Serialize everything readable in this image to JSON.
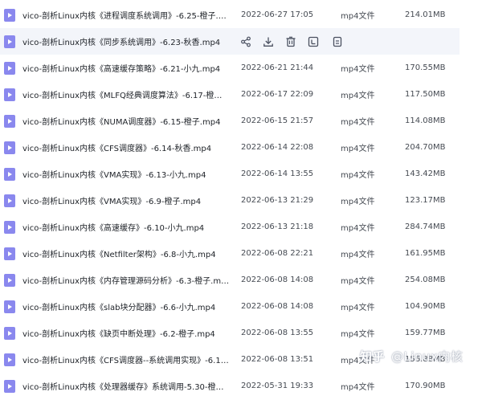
{
  "files": [
    {
      "name": "vico-剖析Linux内核《进程调度系统调用》-6.25-橙子.mp4",
      "date": "2022-06-27 17:05",
      "type": "mp4文件",
      "size": "214.01MB"
    },
    {
      "name": "vico-剖析Linux内核《同步系统调用》-6.23-秋香.mp4",
      "date": "",
      "type": "",
      "size": ""
    },
    {
      "name": "vico-剖析Linux内核《高速缓存策略》-6.21-小九.mp4",
      "date": "2022-06-21 21:44",
      "type": "mp4文件",
      "size": "170.55MB"
    },
    {
      "name": "vico-剖析Linux内核《MLFQ经典调度算法》-6.17-橙子....",
      "date": "2022-06-17 22:09",
      "type": "mp4文件",
      "size": "117.50MB"
    },
    {
      "name": "vico-剖析Linux内核《NUMA调度器》-6.15-橙子.mp4",
      "date": "2022-06-15 21:57",
      "type": "mp4文件",
      "size": "114.08MB"
    },
    {
      "name": "vico-剖析Linux内核《CFS调度器》-6.14-秋香.mp4",
      "date": "2022-06-14 22:08",
      "type": "mp4文件",
      "size": "204.70MB"
    },
    {
      "name": "vico-剖析Linux内核《VMA实现》-6.13-小九.mp4",
      "date": "2022-06-14 13:55",
      "type": "mp4文件",
      "size": "143.42MB"
    },
    {
      "name": "vico-剖析Linux内核《VMA实现》-6.9-橙子.mp4",
      "date": "2022-06-13 21:29",
      "type": "mp4文件",
      "size": "123.17MB"
    },
    {
      "name": "vico-剖析Linux内核《高速缓存》-6.10-小九.mp4",
      "date": "2022-06-13 21:18",
      "type": "mp4文件",
      "size": "284.74MB"
    },
    {
      "name": "vico-剖析Linux内核《Netfilter架构》-6.8-小九.mp4",
      "date": "2022-06-08 22:21",
      "type": "mp4文件",
      "size": "161.95MB"
    },
    {
      "name": "vico-剖析Linux内核《内存管理源码分析》-6.3-橙子.mp4",
      "date": "2022-06-08 14:08",
      "type": "mp4文件",
      "size": "254.08MB"
    },
    {
      "name": "vico-剖析Linux内核《slab块分配器》-6.6-小九.mp4",
      "date": "2022-06-08 14:08",
      "type": "mp4文件",
      "size": "104.90MB"
    },
    {
      "name": "vico-剖析Linux内核《缺页中断处理》-6.2-橙子.mp4",
      "date": "2022-06-08 13:55",
      "type": "mp4文件",
      "size": "159.77MB"
    },
    {
      "name": "vico-剖析Linux内核《CFS调度器--系统调用实现》-6.1-...",
      "date": "2022-06-08 13:51",
      "type": "mp4文件",
      "size": "156.88MB"
    },
    {
      "name": "vico-剖析Linux内核《处理器缓存》系统调用-5.30-橙子....",
      "date": "2022-05-31 19:33",
      "type": "mp4文件",
      "size": "170.90MB"
    }
  ],
  "hover_row_actions": [
    "share-icon",
    "download-icon",
    "delete-icon",
    "rename-icon",
    "more-icon"
  ],
  "watermark": {
    "brand": "知乎",
    "handle": "@Linux内核"
  },
  "colors": {
    "file_icon": "#8a88ee",
    "hover_row": "#f3f5fa",
    "text": "#1f2329"
  }
}
